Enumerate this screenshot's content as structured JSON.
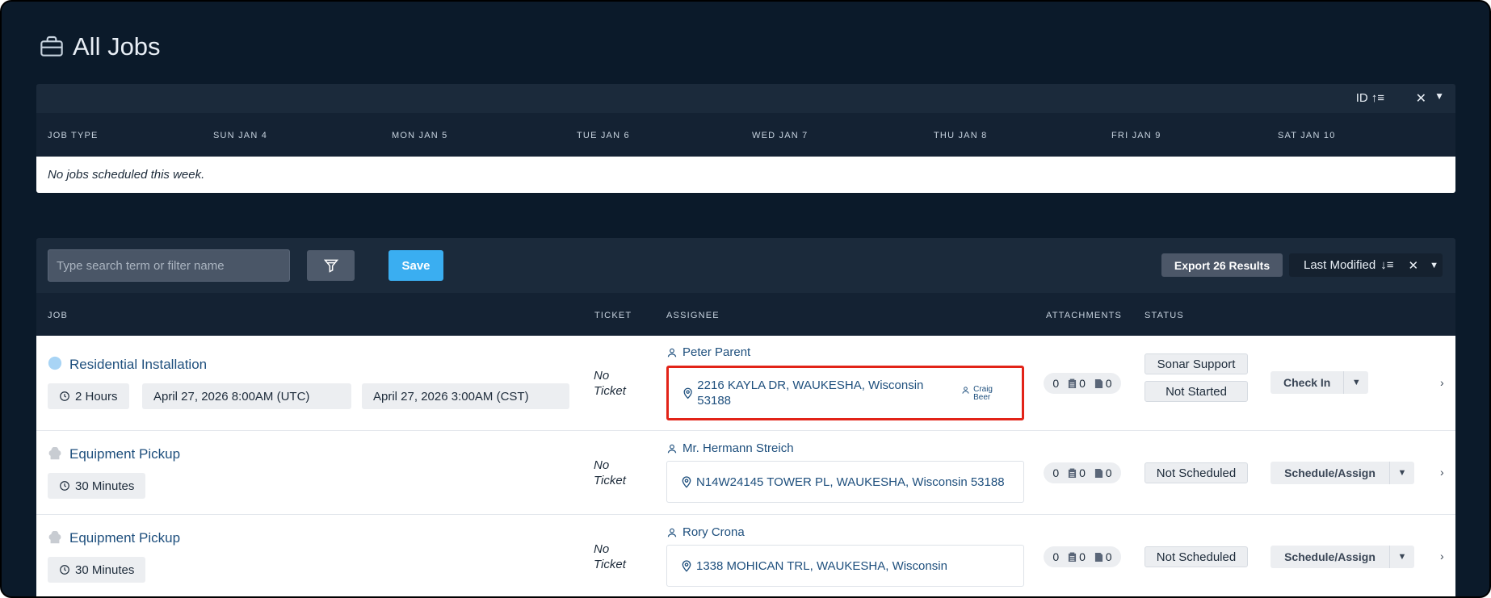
{
  "page": {
    "title": "All Jobs"
  },
  "calendar": {
    "sort_label": "ID",
    "columns": [
      "JOB TYPE",
      "SUN JAN 4",
      "MON JAN 5",
      "TUE JAN 6",
      "WED JAN 7",
      "THU JAN 8",
      "FRI JAN 9",
      "SAT JAN 10"
    ],
    "empty_message": "No jobs scheduled this week."
  },
  "toolbar": {
    "search_placeholder": "Type search term or filter name",
    "save_label": "Save",
    "export_label": "Export 26 Results",
    "sort_label": "Last Modified"
  },
  "table": {
    "headers": [
      "JOB",
      "TICKET",
      "ASSIGNEE",
      "ATTACHMENTS",
      "STATUS"
    ],
    "rows": [
      {
        "title": "Residential Installation",
        "icon": "circle-icon",
        "icon_color": "#a8d4f5",
        "duration": "2 Hours",
        "date_utc": "April 27, 2026 8:00AM (UTC)",
        "date_local": "April 27, 2026 3:00AM (CST)",
        "ticket": [
          "No",
          "Ticket"
        ],
        "assignee": "Peter Parent",
        "address": "2216 KAYLA DR, WAUKESHA, Wisconsin 53188",
        "technician": [
          "Craig",
          "Beer"
        ],
        "attachments": [
          "0",
          "0",
          "0"
        ],
        "statuses": [
          "Sonar Support",
          "Not Started"
        ],
        "action": "Check In"
      },
      {
        "title": "Equipment Pickup",
        "icon": "chef-hat-icon",
        "duration": "30 Minutes",
        "ticket": [
          "No",
          "Ticket"
        ],
        "assignee": "Mr. Hermann Streich",
        "address": "N14W24145 TOWER PL, WAUKESHA, Wisconsin 53188",
        "attachments": [
          "0",
          "0",
          "0"
        ],
        "statuses": [
          "Not Scheduled"
        ],
        "action": "Schedule/Assign"
      },
      {
        "title": "Equipment Pickup",
        "icon": "chef-hat-icon",
        "duration": "30 Minutes",
        "ticket": [
          "No",
          "Ticket"
        ],
        "assignee": "Rory Crona",
        "address": "1338 MOHICAN TRL, WAUKESHA, Wisconsin",
        "attachments": [
          "0",
          "0",
          "0"
        ],
        "statuses": [
          "Not Scheduled"
        ],
        "action": "Schedule/Assign"
      }
    ]
  }
}
